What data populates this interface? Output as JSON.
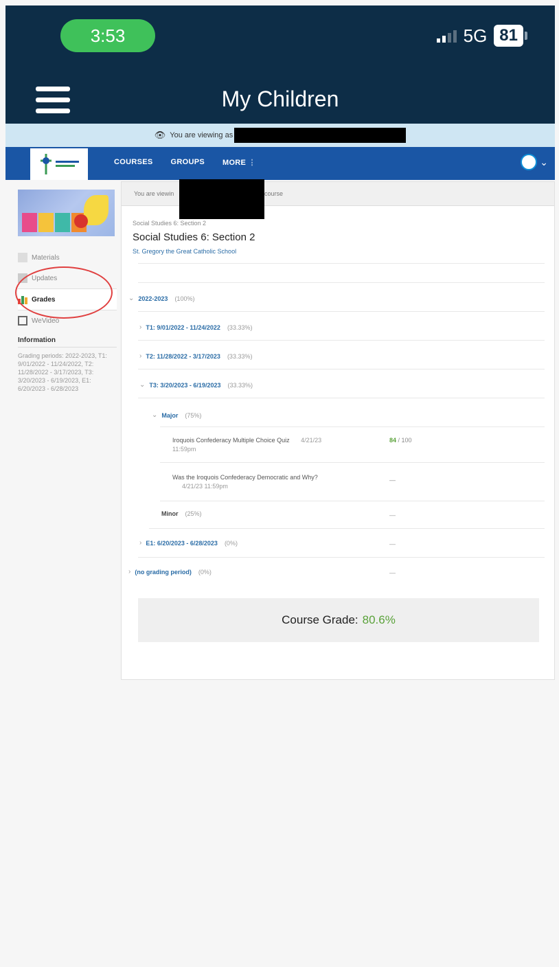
{
  "status_bar": {
    "time": "3:53",
    "network": "5G",
    "battery": "81"
  },
  "app_header": {
    "title": "My Children"
  },
  "viewing_banner": {
    "text": "You are viewing as"
  },
  "nav": {
    "links": [
      "COURSES",
      "GROUPS",
      "MORE"
    ]
  },
  "sidebar": {
    "items": [
      {
        "label": "Materials",
        "icon": "materials-icon"
      },
      {
        "label": "Updates",
        "icon": "updates-icon"
      },
      {
        "label": "Grades",
        "icon": "grades-icon",
        "active": true
      },
      {
        "label": "WeVideo",
        "icon": "wevideo-icon"
      }
    ],
    "info_title": "Information",
    "info_text": "Grading periods: 2022-2023, T1: 9/01/2022 - 11/24/2022, T2: 11/28/2022 - 3/17/2023, T3: 3/20/2023 - 6/19/2023, E1: 6/20/2023 - 6/28/2023"
  },
  "main": {
    "viewing_text_before": "You are viewin",
    "viewing_text_after": "course",
    "breadcrumb": "Social Studies 6: Section 2",
    "course_title": "Social Studies 6: Section 2",
    "school": "St. Gregory the Great Catholic School",
    "year": {
      "label": "2022-2023",
      "pct": "(100%)"
    },
    "periods": [
      {
        "label": "T1: 9/01/2022 - 11/24/2022",
        "pct": "(33.33%)"
      },
      {
        "label": "T2: 11/28/2022 - 3/17/2023",
        "pct": "(33.33%)"
      },
      {
        "label": "T3: 3/20/2023 - 6/19/2023",
        "pct": "(33.33%)"
      }
    ],
    "major": {
      "label": "Major",
      "pct": "(75%)"
    },
    "assignments": [
      {
        "title": "Iroquois Confederacy Multiple Choice Quiz",
        "due": "4/21/23",
        "time": "11:59pm",
        "score": "84",
        "max": "/ 100"
      },
      {
        "title": "Was the Iroquois Confederacy Democratic and Why?",
        "due": "4/21/23 11:59pm",
        "score": "—"
      }
    ],
    "minor": {
      "label": "Minor",
      "pct": "(25%)",
      "score": "—"
    },
    "e1": {
      "label": "E1: 6/20/2023 - 6/28/2023",
      "pct": "(0%)",
      "score": "—"
    },
    "no_period": {
      "label": "(no grading period)",
      "pct": "(0%)",
      "score": "—"
    },
    "course_grade": {
      "label": "Course Grade:",
      "value": "80.6%"
    }
  }
}
